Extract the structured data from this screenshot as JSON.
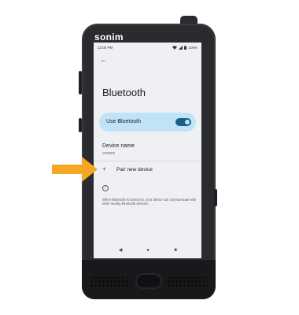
{
  "device": {
    "brand": "sonim"
  },
  "status_bar": {
    "time": "12:00 PM",
    "battery": "100%"
  },
  "screen": {
    "title": "Bluetooth",
    "use_bluetooth_label": "Use Bluetooth",
    "use_bluetooth_on": true,
    "device_name_label": "Device name",
    "device_name_value": "XP9900",
    "pair_new_device_label": "Pair new device",
    "info_text": "When Bluetooth is turned on, your device can communicate with other nearby Bluetooth devices."
  },
  "nav": {
    "back": "◀",
    "home": "●",
    "recents": "■"
  },
  "colors": {
    "accent": "#1d5f86",
    "highlight": "#bfe4f8",
    "pointer": "#f5a623"
  },
  "icons": {
    "back": "back-arrow-icon",
    "add": "plus-icon",
    "info": "info-icon",
    "pointer": "pointer-arrow-icon"
  }
}
